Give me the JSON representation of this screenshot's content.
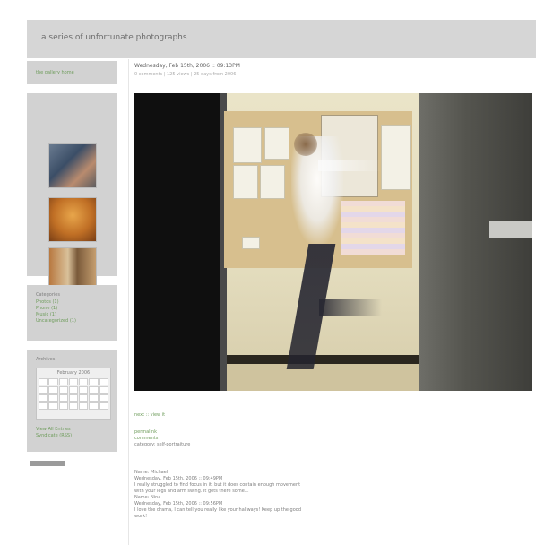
{
  "header": {
    "title": "a series of unfortunate photographs"
  },
  "sidebar": {
    "top_link": "the gallery home",
    "thumbnails": [
      {
        "name": "thumbnail-people"
      },
      {
        "name": "thumbnail-lamp"
      },
      {
        "name": "thumbnail-hall"
      }
    ],
    "categories": {
      "title": "Categories",
      "items": [
        "Photos (1)",
        "Phone (1)",
        "Music (1)",
        "Uncategorized (1)"
      ]
    },
    "archive": {
      "title": "Archives",
      "month_label": "February 2006",
      "links": [
        "View All Entries",
        "Syndicate (RSS)"
      ]
    }
  },
  "post": {
    "title": "Wednesday, Feb 15th, 2006 :: 09:13PM",
    "subtitle": "0 comments | 125 views | 25 days from 2006",
    "under_image_link": "next :: view it",
    "actions": [
      "permalink",
      "comments",
      "category: self-portraiture"
    ],
    "comments": [
      "Name: Michael",
      "Wednesday, Feb 15th, 2006 :: 09:49PM",
      "I really struggled to find focus in it, but it does contain enough movement",
      "with your legs and arm swing. It gets there some...",
      "Name: Nina",
      "Wednesday, Feb 15th, 2006 :: 09:56PM",
      "I love the drama, I can tell you really like your hallways! Keep up the good",
      "work!"
    ]
  }
}
